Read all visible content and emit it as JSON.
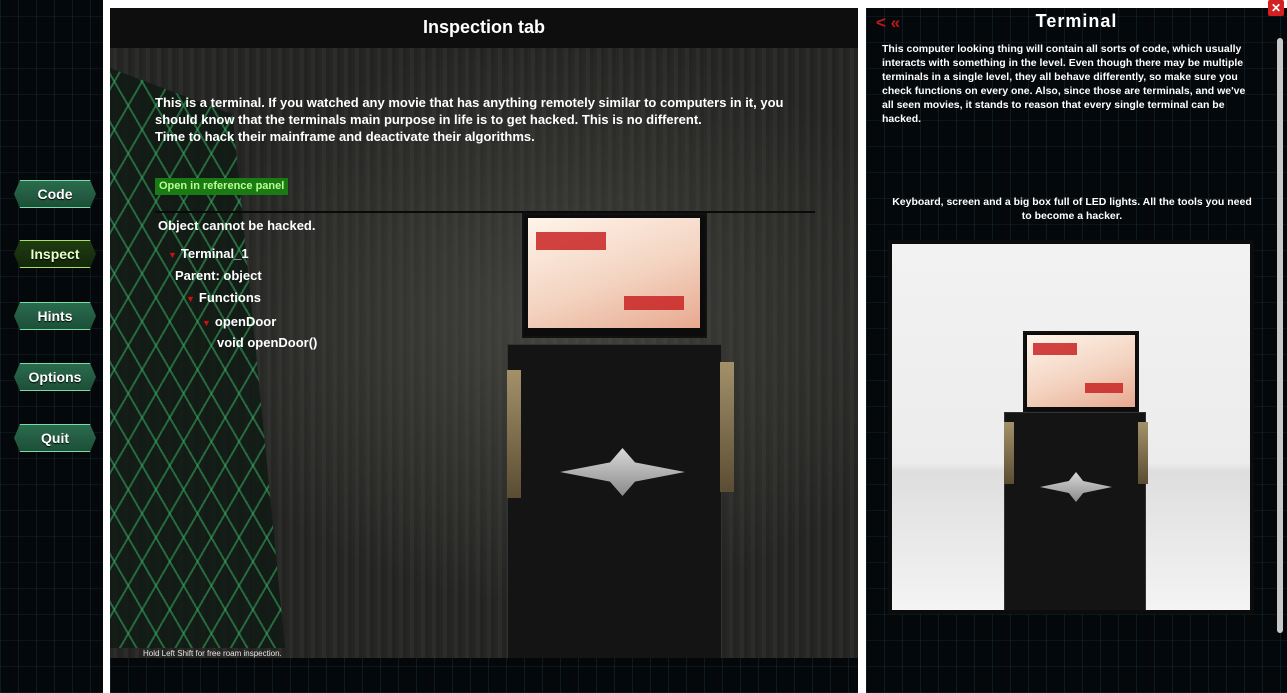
{
  "menu": {
    "items": [
      {
        "label": "Code",
        "active": false
      },
      {
        "label": "Inspect",
        "active": true
      },
      {
        "label": "Hints",
        "active": false
      },
      {
        "label": "Options",
        "active": false
      },
      {
        "label": "Quit",
        "active": false
      }
    ]
  },
  "inspection": {
    "title": "Inspection tab",
    "description": "This is a terminal. If you watched any movie that has anything remotely similar to computers in it, you should know that the terminals main purpose in life is to get hacked. This is no different.\nTime to hack their mainframe and deactivate their algorithms.",
    "reference_button": "Open in reference panel",
    "status": "Object cannot be hacked.",
    "tree": {
      "object_name": "Terminal_1",
      "parent": "Parent: object",
      "functions": "Functions",
      "function_name": "openDoor",
      "signature": "void openDoor()"
    },
    "hint": "Hold Left Shift for free roam inspection."
  },
  "reference": {
    "title": "Terminal",
    "back_icon": "double-chevron-left",
    "close_icon": "close-x",
    "description": "This computer looking thing will contain all sorts of code, which usually interacts with something in the level. Even though there may be multiple terminals in a single level, they all behave differently, so make sure you check functions on every one. Also, since those are terminals, and we've all seen movies, it stands to reason that every single terminal can be hacked.",
    "image_caption": "Keyboard, screen and a big box full of LED lights. All the tools you need to become a hacker."
  },
  "colors": {
    "accent_red": "#c01818",
    "menu_green": "#2a6b4d",
    "reference_green": "#1a7a14"
  }
}
